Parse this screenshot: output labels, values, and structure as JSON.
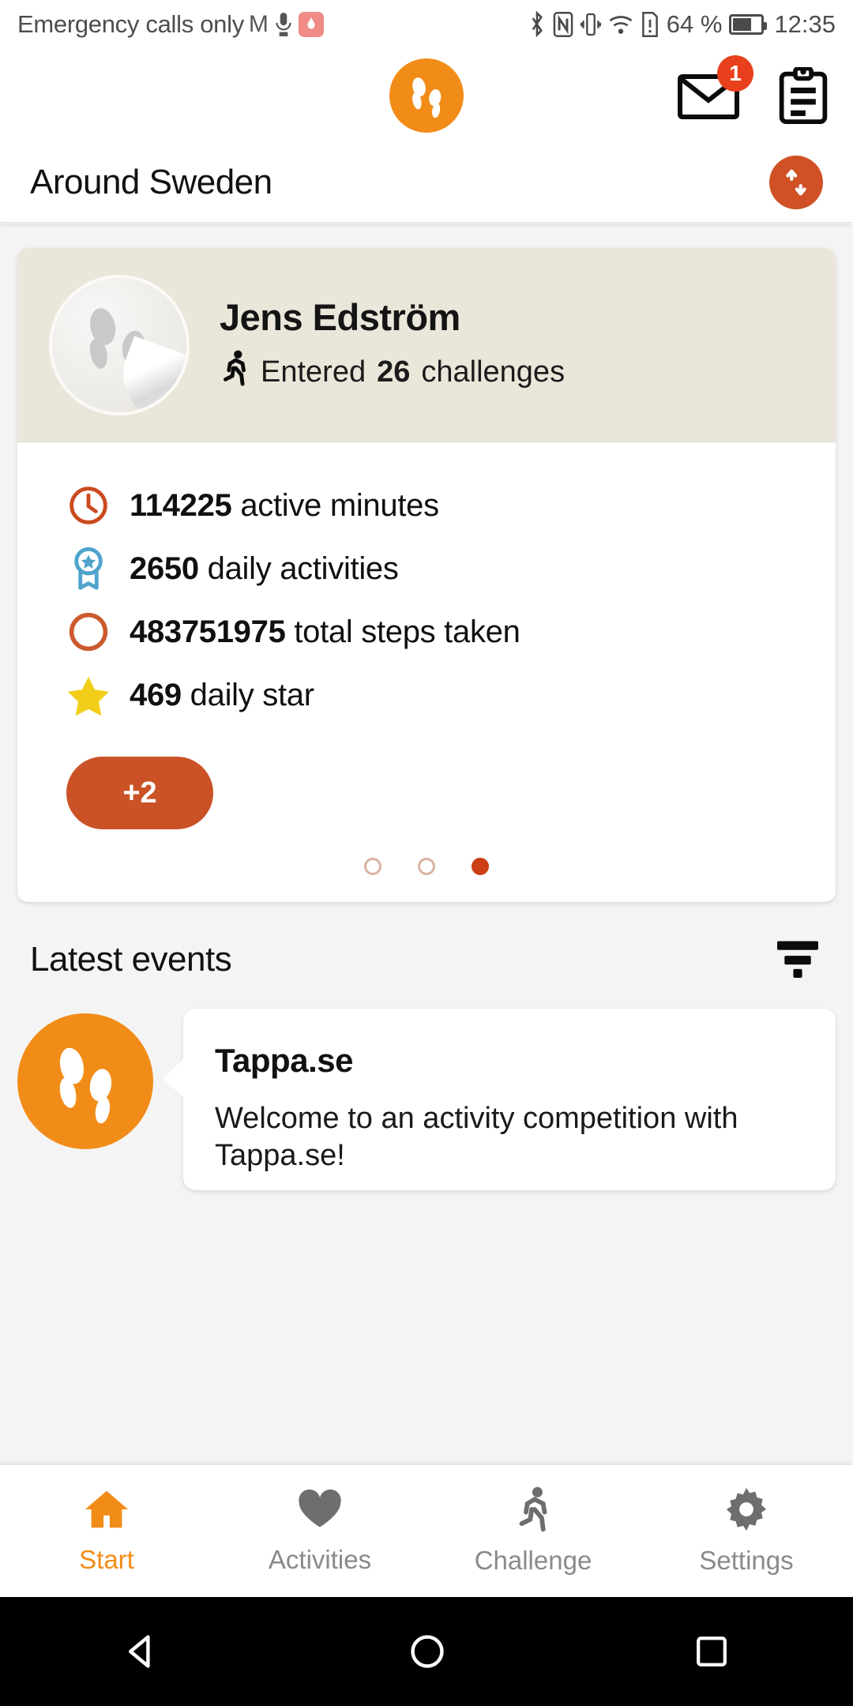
{
  "status_bar": {
    "carrier_text": "Emergency calls only",
    "icons": [
      "gmail-icon",
      "mic-icon",
      "huawei-icon",
      "bluetooth-icon",
      "nfc-icon",
      "vibrate-icon",
      "wifi-icon",
      "sim-alert-icon"
    ],
    "battery_percent": "64 %",
    "time": "12:35"
  },
  "header": {
    "logo_icon": "footprints-logo-icon",
    "mail_icon": "mail-icon",
    "mail_badge": "1",
    "clipboard_icon": "clipboard-icon"
  },
  "title_bar": {
    "title": "Around Sweden",
    "sync_icon": "sync-arrows-icon"
  },
  "profile": {
    "avatar_icon": "footprints-avatar-icon",
    "name": "Jens Edström",
    "challenges_prefix": "Entered",
    "challenges_count": "26",
    "challenges_suffix": "challenges",
    "runner_icon": "running-person-icon",
    "stats": [
      {
        "icon": "clock-icon",
        "value": "114225",
        "label": "active minutes",
        "color": "#CC4A1E"
      },
      {
        "icon": "medal-icon",
        "value": "2650",
        "label": "daily activities",
        "color": "#4FA3CC"
      },
      {
        "icon": "ring-icon",
        "value": "483751975",
        "label": "total steps taken",
        "color": "#CC5A2E"
      },
      {
        "icon": "star-icon",
        "value": "469",
        "label": "daily star",
        "color": "#F2CE1B"
      }
    ],
    "more_button": "+2",
    "pagination": {
      "count": 3,
      "active_index": 2
    }
  },
  "latest_events": {
    "heading": "Latest events",
    "filter_icon": "filter-icon",
    "items": [
      {
        "avatar_icon": "footprints-logo-icon",
        "title": "Tappa.se",
        "body": "Welcome to an activity competition with Tappa.se!"
      }
    ]
  },
  "bottom_nav": {
    "items": [
      {
        "label": "Start",
        "icon": "home-icon",
        "active": true
      },
      {
        "label": "Activities",
        "icon": "heart-icon",
        "active": false
      },
      {
        "label": "Challenge",
        "icon": "runner-icon",
        "active": false
      },
      {
        "label": "Settings",
        "icon": "gear-icon",
        "active": false
      }
    ],
    "active_color": "#F28C18"
  },
  "system_nav": {
    "back_icon": "triangle-back-icon",
    "home_icon": "circle-home-icon",
    "recents_icon": "square-recents-icon"
  }
}
